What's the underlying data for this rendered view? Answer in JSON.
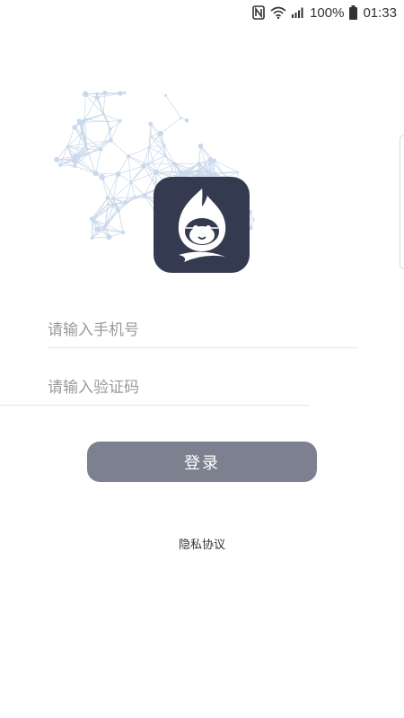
{
  "status_bar": {
    "battery": "100%",
    "time": "01:33"
  },
  "icons": {
    "nfc": "nfc-icon",
    "wifi": "wifi-icon",
    "signal": "signal-icon",
    "battery": "battery-icon",
    "logo": "monkey-logo-icon"
  },
  "colors": {
    "logo_bg": "#343a4f",
    "button_bg": "#7d818f",
    "network": "#c9d8ea"
  },
  "form": {
    "phone_placeholder": "请输入手机号",
    "code_placeholder": "请输入验证码",
    "login_label": "登录"
  },
  "footer": {
    "privacy_label": "隐私协议"
  }
}
